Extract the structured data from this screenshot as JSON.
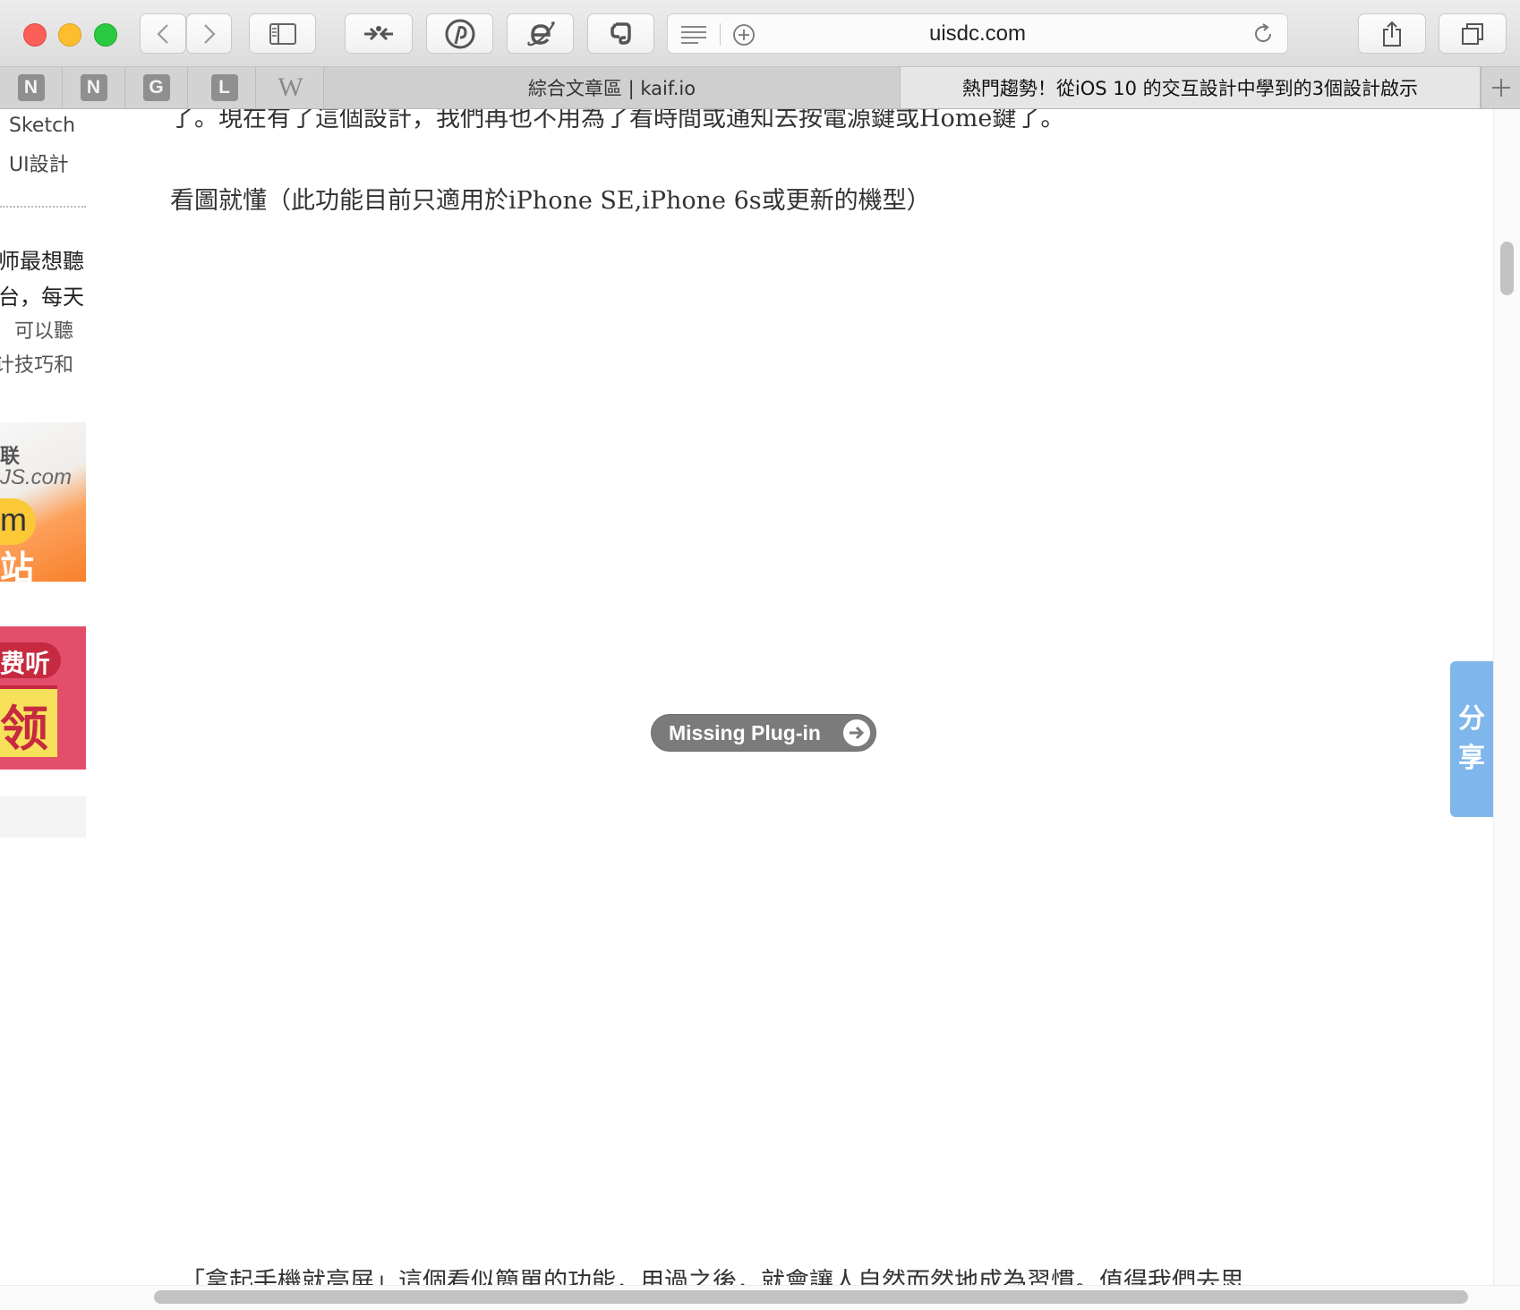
{
  "toolbar": {
    "url": "uisdc.com",
    "buttons": [
      "back-icon",
      "forward-icon",
      "sidebar-icon",
      "extension-arrows-icon",
      "pinterest-icon",
      "ie-icon",
      "evernote-icon",
      "share-icon",
      "tabs-overview-icon"
    ]
  },
  "pinned_tabs": [
    {
      "letter": "N"
    },
    {
      "letter": "N"
    },
    {
      "letter": "G"
    },
    {
      "letter": "L"
    },
    {
      "letter": "W"
    }
  ],
  "tabs": [
    {
      "title": "綜合文章區 | kaif.io",
      "active": false
    },
    {
      "title": "熱門趨勢！從iOS 10 的交互設計中學到的3個設計啟示",
      "active": true
    }
  ],
  "sidebar": {
    "links": [
      "Sketch",
      "UI設計"
    ],
    "promo_lines": [
      "师最想聽",
      "台，每天",
      "可以聽",
      "计技巧和"
    ],
    "ad1": {
      "line1": "联",
      "line2": "JS.com",
      "line3": "m",
      "line4": "站"
    },
    "ad2": {
      "line1": "费听",
      "line2": "领"
    }
  },
  "article": {
    "top_line": "了。現在有了這個設計，我們再也不用為了看時間或通知去按電源鍵或Home鍵了。",
    "paragraph1": "看圖就懂（此功能目前只適用於iPhone SE,iPhone 6s或更新的機型）",
    "plugin_label": "Missing Plug-in",
    "bottom_line": "「拿起手機就亮屏」這個看似簡單的功能，用過之後，就會讓人自然而然地成為習慣。值得我們去思"
  },
  "share": {
    "chars": [
      "分",
      "享"
    ]
  },
  "colors": {
    "share_bg": "#7fb6ec",
    "plugin_bg": "#7b7b7b",
    "close": "#fc5f57",
    "minimize": "#fdbd2e",
    "maximize": "#29c940"
  }
}
